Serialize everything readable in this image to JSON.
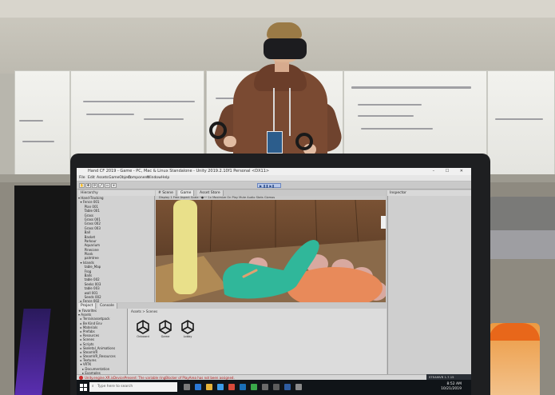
{
  "window": {
    "title": "Hand CF 2019 - Game - PC, Mac & Linux Standalone - Unity 2019.2.10f1 Personal <DX11>",
    "controls": "– ☐ ✕"
  },
  "menu": [
    "File",
    "Edit",
    "Assets",
    "GameObject",
    "Component",
    "Window",
    "Help"
  ],
  "toolbar": {
    "tools": [
      "✋",
      "✥",
      "⟳",
      "⤢",
      "▭",
      "⌖"
    ],
    "play": "▶ ❚❚ ▶❚"
  },
  "hierarchy": {
    "tab": "Hierarchy",
    "rows": [
      "▾ Hand-Tracking",
      "  ▾ Fence 001",
      "      Plan 001",
      "      Table 001",
      "      Grass",
      "      Grass 001",
      "      Grass 002",
      "      Grass 003",
      "      Ball",
      "      Basket",
      "      Parkour",
      "      Aquarium",
      "      Pinecone",
      "      Plank",
      "      palmtree",
      "  ▾ Islands",
      "      table_Map",
      "      Frog",
      "      Balls",
      "      table 002",
      "      Seeks 003",
      "      table 003",
      "      wall 001",
      "      Seeds 002",
      "  ▸ Fence 002",
      "      gamemanager",
      "      Point Key Test",
      "      Fire"
    ]
  },
  "viewTabs": {
    "scene": "# Scene",
    "game": "Game",
    "asset": "Asset Store",
    "options": "Display 1  Free Aspect  Scale ─●── 1x  Maximize On Play  Mute Audio  Stats  Gizmos"
  },
  "inspector": {
    "tab": "Inspector"
  },
  "project": {
    "tabs": [
      "Project",
      "Console"
    ],
    "breadcrumb": "Assets > Scenes",
    "tree": [
      "★ Favorites",
      "▾ Assets",
      "  ▸ Terrainassetpack",
      "  ▸ Be Kind Env",
      "  ▸ Materials",
      "  ▸ Prefabs",
      "  ▸ Resources",
      "  ▸ Scenes",
      "  ▸ Scripts",
      "  ▸ Skeletal_Animations",
      "  ▸ SteamVR",
      "  ▸ SteamVR_Resources",
      "  ▸ Textures",
      "  ▾ VRTK",
      "    ▸ Documentation",
      "    ▸ Examples"
    ],
    "assets": [
      "Onboard",
      "Game",
      "Lobby"
    ]
  },
  "status": {
    "message": "Unity.engine.XR.isDevicePresent: The variable ringBlocker of PlayArea has not been assigned."
  },
  "notification": "STEAMVR 1.7.15",
  "taskbar": {
    "search_placeholder": "Type here to search",
    "time": "8:52 AM",
    "date": "10/21/2019"
  }
}
